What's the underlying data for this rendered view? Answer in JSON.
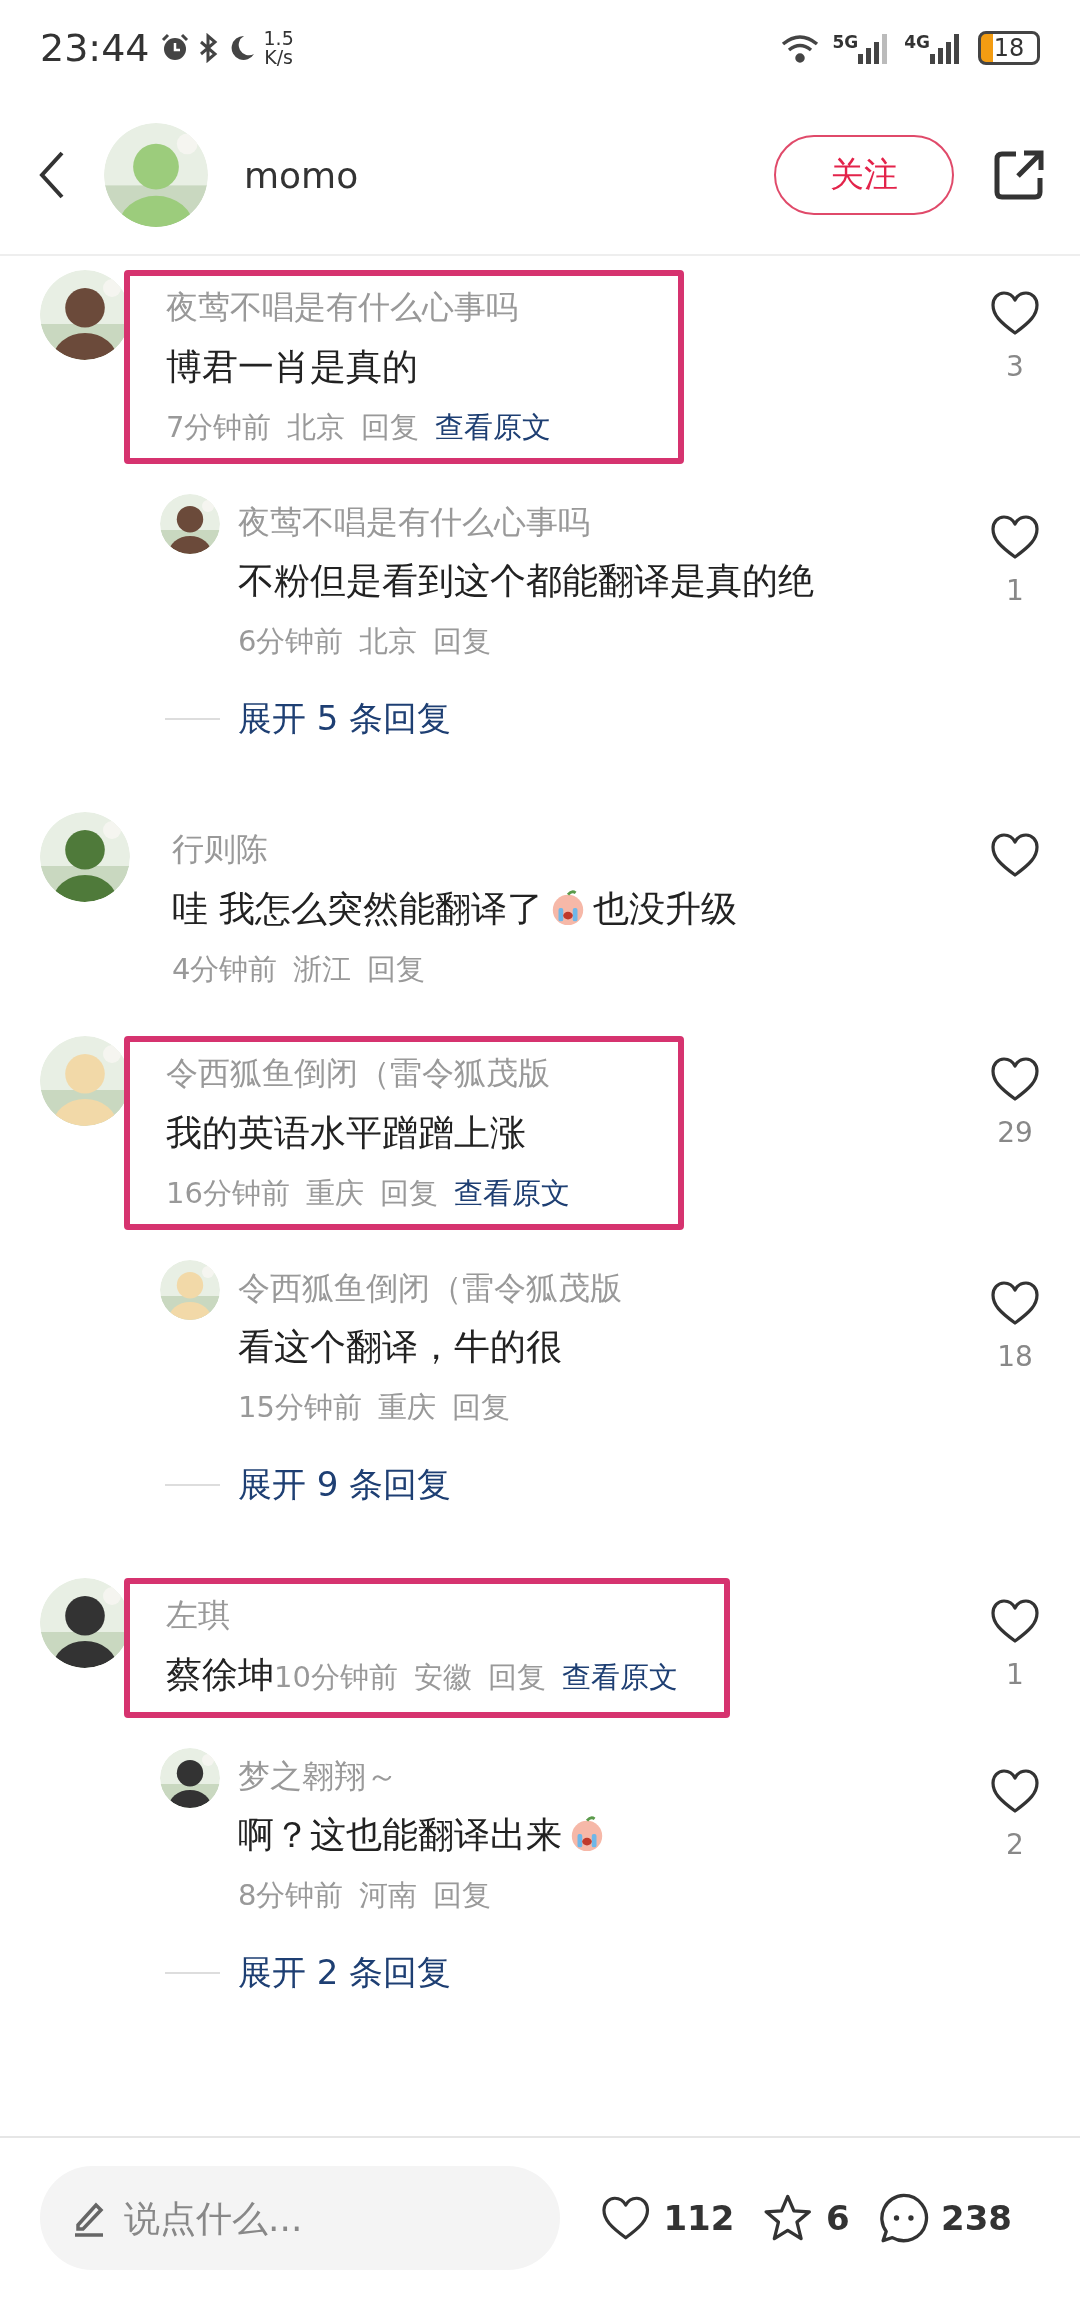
{
  "status_bar": {
    "time": "23:44",
    "speed_value": "1.5",
    "speed_unit": "K/s",
    "net1": "5G",
    "net2": "4G",
    "battery": "18"
  },
  "header": {
    "name": "momo",
    "follow_label": "关注"
  },
  "comments": [
    {
      "user": "夜莺不唱是有什么心事吗",
      "parts": [
        {
          "kind": "text",
          "text": "博君一肖是真的"
        }
      ],
      "time": "7分钟前",
      "place": "北京",
      "reply_label": "回复",
      "original_label": "查看原文",
      "likes": "3",
      "highlighted": true,
      "meta_inline": false,
      "replies": [
        {
          "user": "夜莺不唱是有什么心事吗",
          "parts": [
            {
              "kind": "text",
              "text": "不粉但是看到这个都能翻译是真的绝"
            }
          ],
          "time": "6分钟前",
          "place": "北京",
          "reply_label": "回复",
          "likes": "1"
        }
      ],
      "expand": "展开 5 条回复"
    },
    {
      "user": "行则陈",
      "parts": [
        {
          "kind": "text",
          "text": "哇 我怎么突然能翻译了"
        },
        {
          "kind": "emoji"
        },
        {
          "kind": "text",
          "text": "也没升级"
        }
      ],
      "time": "4分钟前",
      "place": "浙江",
      "reply_label": "回复",
      "highlighted": false,
      "meta_inline": false
    },
    {
      "user": "令西狐鱼倒闭（雷令狐茂版",
      "parts": [
        {
          "kind": "text",
          "text": "我的英语水平蹭蹭上涨"
        }
      ],
      "time": "16分钟前",
      "place": "重庆",
      "reply_label": "回复",
      "original_label": "查看原文",
      "likes": "29",
      "highlighted": true,
      "meta_inline": false,
      "replies": [
        {
          "user": "令西狐鱼倒闭（雷令狐茂版",
          "parts": [
            {
              "kind": "text",
              "text": "看这个翻译，牛的很"
            }
          ],
          "time": "15分钟前",
          "place": "重庆",
          "reply_label": "回复",
          "likes": "18"
        }
      ],
      "expand": "展开 9 条回复"
    },
    {
      "user": "左琪",
      "parts": [
        {
          "kind": "text",
          "text": "蔡徐坤"
        }
      ],
      "time": "10分钟前",
      "place": "安徽",
      "reply_label": "回复",
      "original_label": "查看原文",
      "likes": "1",
      "highlighted": true,
      "meta_inline": true,
      "replies": [
        {
          "user": "梦之翱翔～",
          "parts": [
            {
              "kind": "text",
              "text": "啊？这也能翻译出来"
            },
            {
              "kind": "emoji"
            }
          ],
          "time": "8分钟前",
          "place": "河南",
          "reply_label": "回复",
          "likes": "2"
        }
      ],
      "expand": "展开 2 条回复"
    }
  ],
  "bottom_bar": {
    "placeholder": "说点什么...",
    "likes": "112",
    "stars": "6",
    "comments": "238"
  }
}
